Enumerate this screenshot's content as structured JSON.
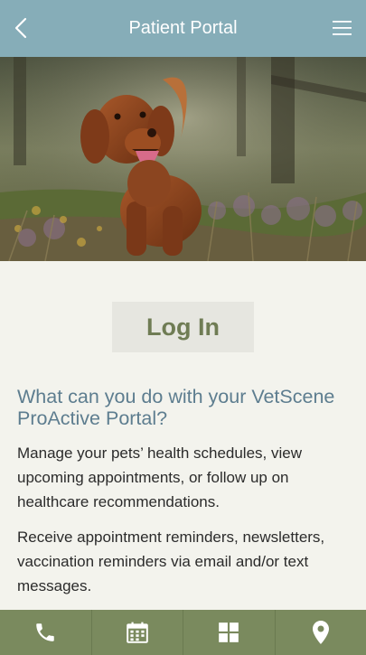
{
  "header": {
    "title": "Patient Portal",
    "back_icon": "chevron-left-icon",
    "menu_icon": "hamburger-menu-icon"
  },
  "hero": {
    "description_icon": "dog-photo"
  },
  "login": {
    "label": "Log In"
  },
  "info": {
    "heading": "What can you do with your VetScene ProActive Portal?",
    "paragraph1": "Manage your pets’ health schedules, view upcoming appointments, or follow up on healthcare recommendations.",
    "paragraph2": "Receive appointment reminders, newsletters, vaccination reminders via email and/or text messages."
  },
  "tabbar": {
    "items": [
      {
        "icon": "phone-icon"
      },
      {
        "icon": "calendar-icon"
      },
      {
        "icon": "grid-icon"
      },
      {
        "icon": "location-pin-icon"
      }
    ]
  },
  "colors": {
    "header": "#86adb8",
    "tabbar": "#7a8a5e",
    "heading": "#5d7d8f",
    "login_text": "#6f7c54",
    "background": "#f3f3ed"
  }
}
